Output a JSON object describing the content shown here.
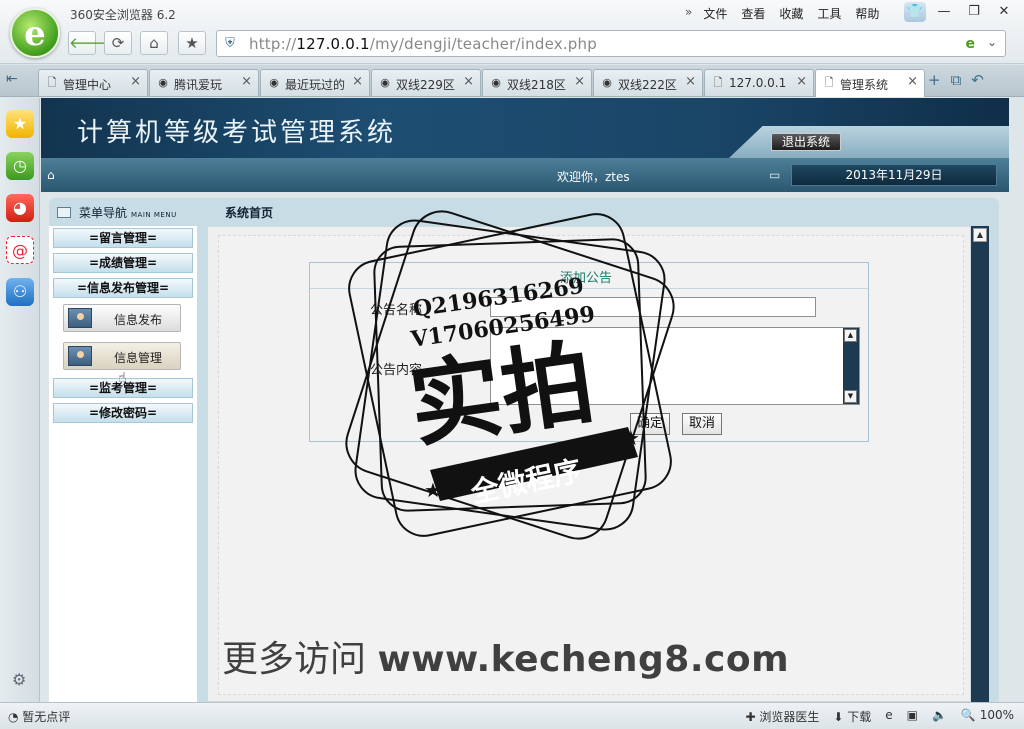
{
  "browser": {
    "app_title": "360安全浏览器 6.2",
    "menu": [
      "文件",
      "查看",
      "收藏",
      "工具",
      "帮助"
    ],
    "url_prefix": "http://",
    "url_host": "127.0.0.1",
    "url_path": "/my/dengji/teacher/index.php",
    "tabs": [
      {
        "label": "管理中心",
        "icon": "page-icon"
      },
      {
        "label": "腾讯爱玩",
        "icon": "chrome-icon"
      },
      {
        "label": "最近玩过的",
        "icon": "chrome-icon"
      },
      {
        "label": "双线229区",
        "icon": "chrome-icon"
      },
      {
        "label": "双线218区",
        "icon": "chrome-icon"
      },
      {
        "label": "双线222区",
        "icon": "chrome-icon"
      },
      {
        "label": "127.0.0.1",
        "icon": "page-icon"
      },
      {
        "label": "管理系统",
        "icon": "page-icon",
        "active": true
      }
    ],
    "status_left": "暂无点评",
    "status_right": [
      "浏览器医生",
      "下载",
      "100%"
    ]
  },
  "site": {
    "system_title": "计算机等级考试管理系统",
    "logout": "退出系统",
    "welcome": "欢迎你，ztes",
    "date": "2013年11月29日",
    "nav_title": "菜单导航",
    "nav_title_en": "MAIN MENU",
    "breadcrumb": "系统首页",
    "menu": {
      "item1": "=留言管理=",
      "item2": "=成绩管理=",
      "item3": "=信息发布管理=",
      "sub1": "信息发布",
      "sub2": "信息管理",
      "item4": "=监考管理=",
      "item5": "=修改密码="
    },
    "form": {
      "title": "添加公告",
      "name_label": "公告名称",
      "content_label": "公告内容",
      "confirm": "确定",
      "cancel": "取消"
    }
  },
  "watermark": {
    "line1": "Q2196316269",
    "line2": "V17060256499",
    "big": "实拍",
    "ribbon": "全微程序",
    "url_cn": "更多访问",
    "url": "www.kecheng8.com"
  },
  "colors": {
    "banner": "#1d4e73",
    "accent_green": "#4c9a1c",
    "form_title": "#1b7a6a"
  }
}
